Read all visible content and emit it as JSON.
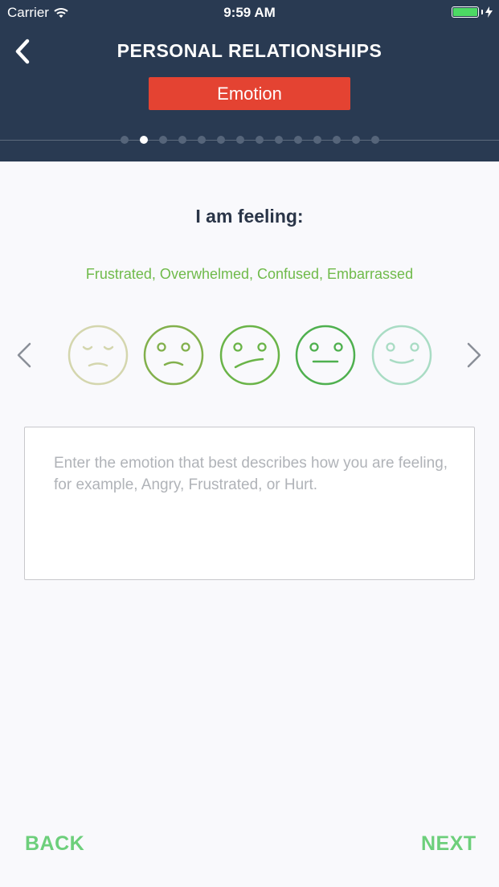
{
  "status_bar": {
    "carrier": "Carrier",
    "time": "9:59 AM",
    "battery_color": "#4cd964"
  },
  "header": {
    "title": "PERSONAL RELATIONSHIPS",
    "category": "Emotion",
    "category_color": "#e44332",
    "background_color": "#293a52",
    "progress": {
      "steps_total": 14,
      "current_step": 2
    }
  },
  "question": {
    "prompt": "I am feeling:",
    "emotion_words": "Frustrated, Overwhelmed, Confused, Embarrassed",
    "emotion_words_color": "#6fba4a"
  },
  "faces": [
    {
      "icon": "sleepy-face-icon",
      "color": "#d4d6ae"
    },
    {
      "icon": "frown-face-icon",
      "color": "#82b04c"
    },
    {
      "icon": "confused-face-icon",
      "color": "#6ab448"
    },
    {
      "icon": "neutral-face-icon",
      "color": "#4fb04f"
    },
    {
      "icon": "smile-face-icon",
      "color": "#a9dcc4"
    }
  ],
  "carousel": {
    "prev_icon": "chevron-left-icon",
    "next_icon": "chevron-right-icon"
  },
  "input": {
    "placeholder": "Enter the emotion that best describes how you are feeling, for example, Angry, Frustrated, or Hurt."
  },
  "footer": {
    "back_label": "BACK",
    "next_label": "NEXT",
    "accent_color": "#6dcf7b"
  }
}
